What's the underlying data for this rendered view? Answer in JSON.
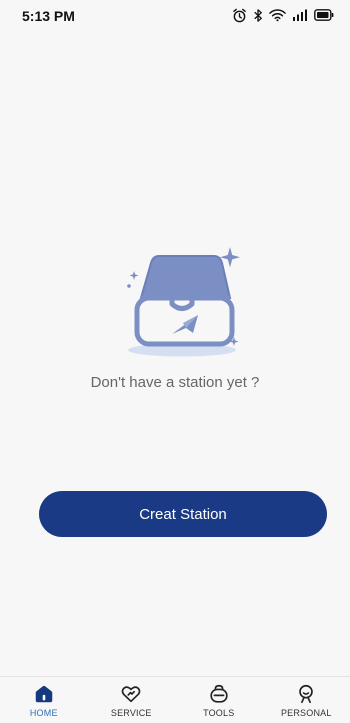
{
  "status_bar": {
    "time": "5:13 PM",
    "icons": [
      "alarm-icon",
      "bluetooth-icon",
      "wifi-icon",
      "signal-icon",
      "battery-icon"
    ]
  },
  "main": {
    "empty_message": "Don't have a station yet ?",
    "illustration": "empty-inbox-icon",
    "create_button_label": "Creat Station"
  },
  "bottom_nav": {
    "active": "HOME",
    "items": [
      {
        "label": "HOME",
        "icon": "home-icon"
      },
      {
        "label": "SERVICE",
        "icon": "heart-service-icon"
      },
      {
        "label": "TOOLS",
        "icon": "tools-icon"
      },
      {
        "label": "PERSONAL",
        "icon": "person-icon"
      }
    ]
  },
  "colors": {
    "background": "#f7f7f7",
    "primary": "#1a3a86",
    "active_nav": "#2f6fb7",
    "illustration": "#7c8fc4"
  }
}
